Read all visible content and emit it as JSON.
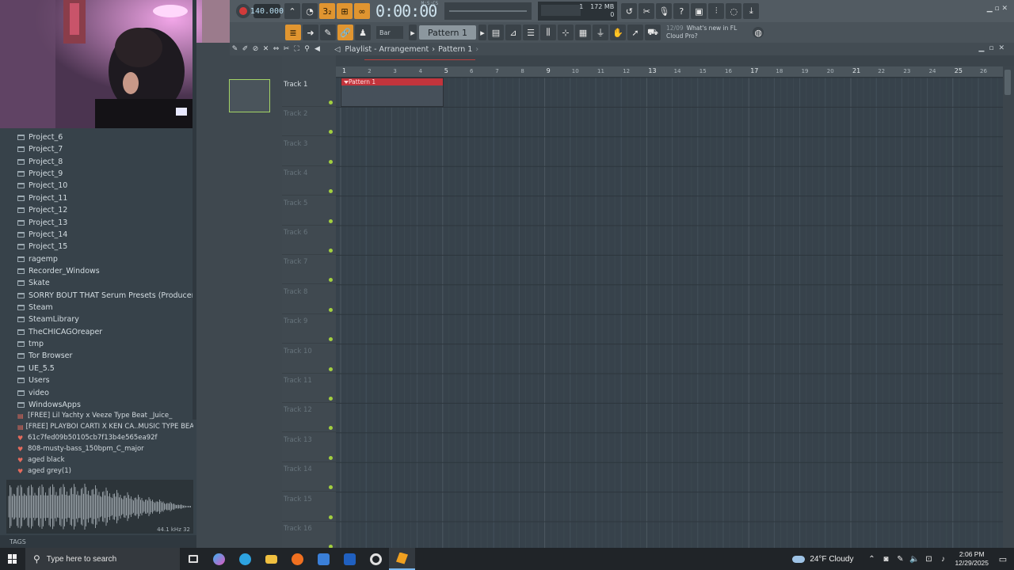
{
  "toolbar": {
    "tempo": "140.000",
    "time_display": "0:00:00",
    "time_unit": "M:S:CS",
    "cpu_memory": "172 MB",
    "cpu_polyphony": "0",
    "cpu_top_value": "1",
    "pattern_selector": "Pattern 1",
    "snap_mode": "Bar",
    "news_date": "12/09",
    "news_line1": "What's new in FL",
    "news_line2": "Cloud Pro?"
  },
  "playlist": {
    "title": "Playlist - Arrangement",
    "separator": "›",
    "current_pattern": "Pattern 1",
    "bars": [
      "1",
      "2",
      "3",
      "4",
      "5",
      "6",
      "7",
      "8",
      "9",
      "10",
      "11",
      "12",
      "13",
      "14",
      "15",
      "16",
      "17",
      "18",
      "19",
      "20",
      "21",
      "22",
      "23",
      "24",
      "25",
      "26"
    ],
    "tracks": [
      "Track 1",
      "Track 2",
      "Track 3",
      "Track 4",
      "Track 5",
      "Track 6",
      "Track 7",
      "Track 8",
      "Track 9",
      "Track 10",
      "Track 11",
      "Track 12",
      "Track 13",
      "Track 14",
      "Track 15",
      "Track 16"
    ],
    "clip_label": "Pattern 1"
  },
  "browser": {
    "folders": [
      "Project_6",
      "Project_7",
      "Project_8",
      "Project_9",
      "Project_10",
      "Project_11",
      "Project_12",
      "Project_13",
      "Project_14",
      "Project_15",
      "ragemp",
      "Recorder_Windows",
      "Skate",
      "SORRY BOUT THAT Serum Presets (Producergrind)",
      "Steam",
      "SteamLibrary",
      "TheCHICAGOreaper",
      "tmp",
      "Tor Browser",
      "UE_5.5",
      "Users",
      "video",
      "WindowsApps"
    ],
    "files": [
      {
        "icon": "wav-icon",
        "label": "[FREE] Lil Yachty x Veeze Type Beat _Juice_"
      },
      {
        "icon": "wav-icon",
        "label": "[FREE] PLAYBOI CARTI X KEN CA..MUSIC TYPE BEAT - DAYTONA"
      },
      {
        "icon": "audio-icon",
        "label": "61c7fed09b50105cb7f13b4e565ea92f"
      },
      {
        "icon": "audio-icon",
        "label": "808-musty-bass_150bpm_C_major"
      },
      {
        "icon": "audio-icon",
        "label": "aged black"
      },
      {
        "icon": "audio-icon",
        "label": "aged grey(1)"
      }
    ],
    "wave_info": "44.1 kHz 32",
    "tags_label": "TAGS"
  },
  "taskbar": {
    "search_placeholder": "Type here to search",
    "weather": "24°F  Cloudy",
    "time": "2:06 PM",
    "date": "12/29/2025"
  },
  "colors": {
    "accent_orange": "#e09530",
    "clip_red": "#c2343c",
    "track_dot_green": "#a2cf3f"
  }
}
